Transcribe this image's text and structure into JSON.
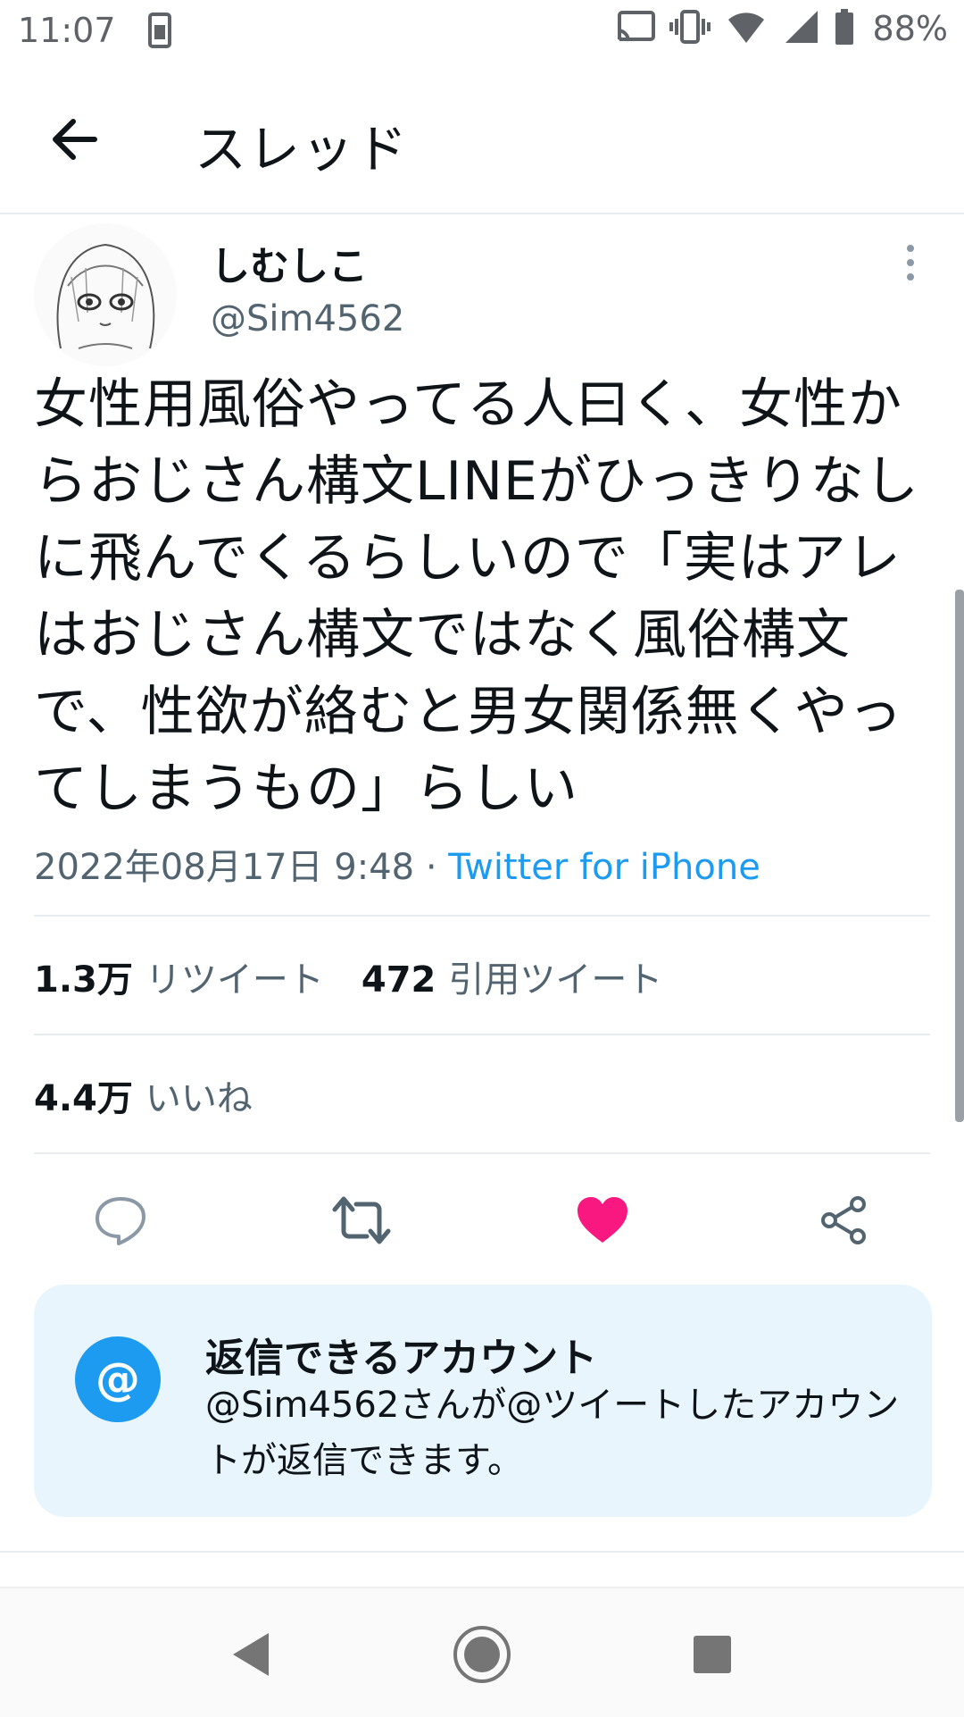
{
  "status_bar": {
    "time": "11:07",
    "battery": "88%",
    "icons": [
      "sim-card-icon",
      "cast-icon",
      "vibrate-icon",
      "wifi-icon",
      "signal-icon",
      "battery-icon"
    ]
  },
  "header": {
    "title": "スレッド",
    "back_icon": "arrow-left-icon"
  },
  "tweet": {
    "display_name": "しむしこ",
    "handle": "@Sim4562",
    "text": "女性用風俗やってる人曰く、女性からおじさん構文LINEがひっきりなしに飛んでくるらしいので「実はアレはおじさん構文ではなく風俗構文で、性欲が絡むと男女関係無くやってしまうもの」らしい",
    "timestamp": "2022年08月17日 9:48",
    "separator": " · ",
    "source": "Twitter for iPhone"
  },
  "stats": {
    "retweets_count": "1.3万",
    "retweets_label": "リツイート",
    "quotes_count": "472",
    "quotes_label": "引用ツイート",
    "likes_count": "4.4万",
    "likes_label": "いいね"
  },
  "actions": [
    "reply-icon",
    "retweet-icon",
    "like-icon",
    "share-icon"
  ],
  "reply_card": {
    "icon_text": "@",
    "title": "返信できるアカウント",
    "description": "@Sim4562さんが@ツイートしたアカウントが返信できます。"
  },
  "colors": {
    "accent": "#1d9bf0",
    "like": "#f91880",
    "secondary_text": "#536471",
    "card_bg": "#e8f5fd"
  }
}
